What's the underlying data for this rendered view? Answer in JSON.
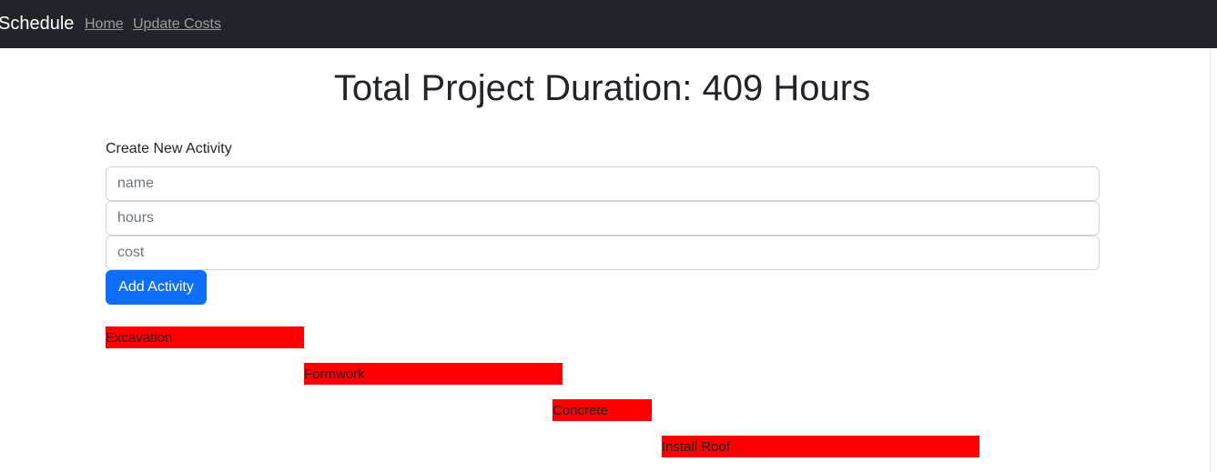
{
  "navbar": {
    "brand": "Schedule",
    "links": [
      "Home",
      "Update Costs"
    ]
  },
  "main": {
    "title": "Total Project Duration: 409 Hours",
    "form": {
      "label": "Create New Activity",
      "name_placeholder": "name",
      "hours_placeholder": "hours",
      "cost_placeholder": "cost",
      "submit_label": "Add Activity"
    }
  },
  "colors": {
    "navbar_bg": "#212529",
    "primary_button": "#0d6efd",
    "activity_bar": "#ff0000"
  },
  "activities": [
    {
      "name": "Excavation"
    },
    {
      "name": "Formwork"
    },
    {
      "name": "Concrete"
    },
    {
      "name": "Install Roof"
    }
  ]
}
